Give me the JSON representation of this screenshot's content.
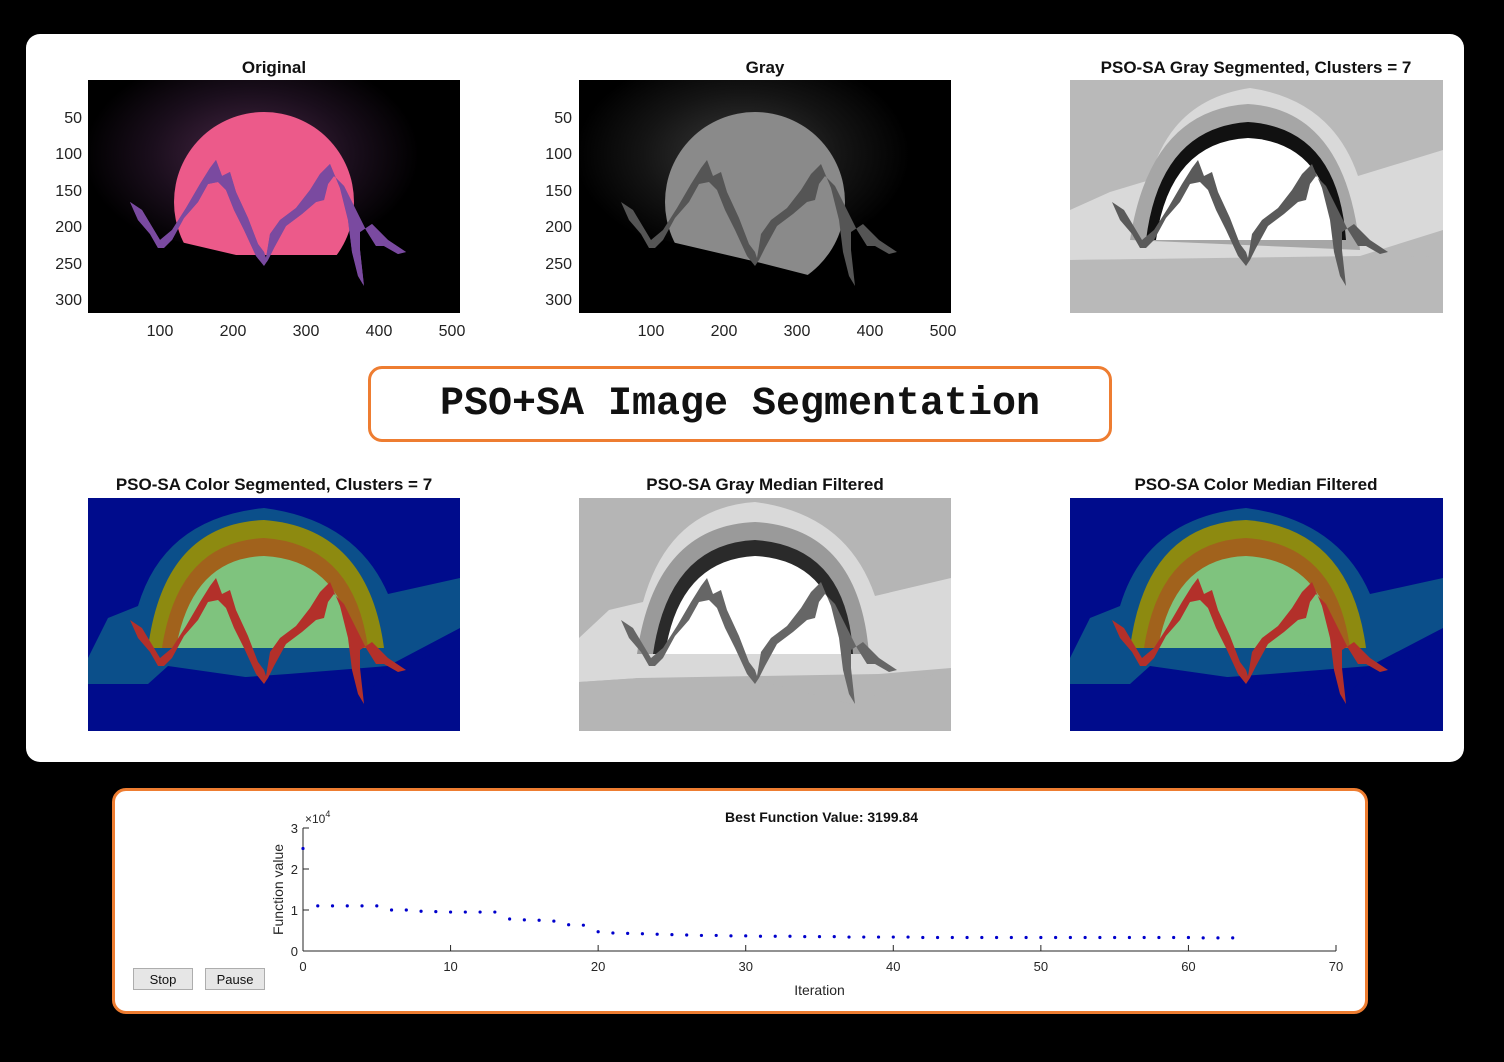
{
  "figure": {
    "row1": [
      {
        "title": "Original",
        "render": "color"
      },
      {
        "title": "Gray",
        "render": "gray"
      },
      {
        "title": "PSO-SA Gray Segmented, Clusters = 7",
        "render": "seg-gray"
      }
    ],
    "row2": [
      {
        "title": "PSO-SA Color Segmented, Clusters = 7",
        "render": "seg-color"
      },
      {
        "title": "PSO-SA Gray Median Filtered",
        "render": "seg-gray"
      },
      {
        "title": "PSO-SA Color Median Filtered",
        "render": "seg-color"
      }
    ],
    "y_ticks": [
      "50",
      "100",
      "150",
      "200",
      "250",
      "300"
    ],
    "x_ticks": [
      "100",
      "200",
      "300",
      "400",
      "500"
    ]
  },
  "banner": {
    "text": "PSO+SA Image Segmentation"
  },
  "optim_panel": {
    "stop_label": "Stop",
    "pause_label": "Pause"
  },
  "chart_data": {
    "type": "scatter",
    "title": "Best Function Value: 3199.84",
    "xlabel": "Iteration",
    "ylabel": "Function value",
    "y_exponent_label": "×10",
    "y_exponent": "4",
    "xlim": [
      0,
      70
    ],
    "ylim": [
      0,
      30000
    ],
    "x_ticks": [
      0,
      10,
      20,
      30,
      40,
      50,
      60,
      70
    ],
    "y_ticks": [
      0,
      1,
      2,
      3
    ],
    "marker_color": "#0000cc",
    "x": [
      0,
      1,
      2,
      3,
      4,
      5,
      6,
      7,
      8,
      9,
      10,
      11,
      12,
      13,
      14,
      15,
      16,
      17,
      18,
      19,
      20,
      21,
      22,
      23,
      24,
      25,
      26,
      27,
      28,
      29,
      30,
      31,
      32,
      33,
      34,
      35,
      36,
      37,
      38,
      39,
      40,
      41,
      42,
      43,
      44,
      45,
      46,
      47,
      48,
      49,
      50,
      51,
      52,
      53,
      54,
      55,
      56,
      57,
      58,
      59,
      60,
      61,
      62,
      63
    ],
    "y": [
      25000,
      11000,
      11000,
      11000,
      11000,
      11000,
      10000,
      10000,
      9700,
      9600,
      9500,
      9500,
      9500,
      9500,
      7800,
      7600,
      7500,
      7300,
      6400,
      6300,
      4700,
      4400,
      4300,
      4200,
      4100,
      4000,
      3900,
      3800,
      3800,
      3700,
      3700,
      3600,
      3600,
      3600,
      3500,
      3500,
      3500,
      3400,
      3400,
      3400,
      3400,
      3400,
      3300,
      3300,
      3300,
      3300,
      3300,
      3300,
      3300,
      3300,
      3300,
      3300,
      3300,
      3300,
      3300,
      3300,
      3300,
      3300,
      3300,
      3300,
      3300,
      3200,
      3200,
      3200
    ]
  }
}
